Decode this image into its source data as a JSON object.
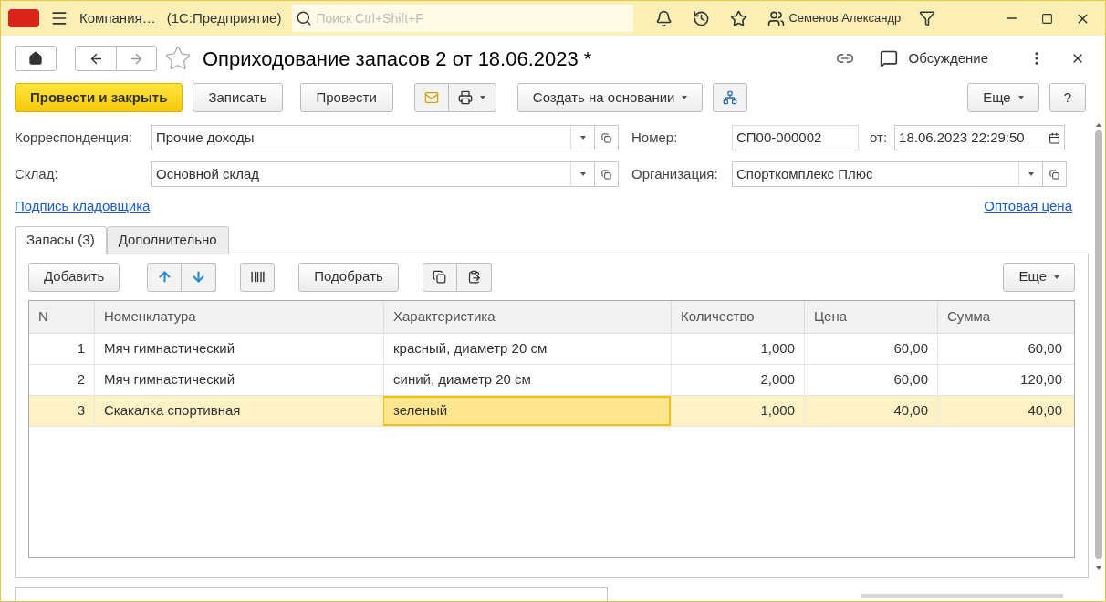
{
  "topbar": {
    "app_name": "Компания…",
    "app_kind": "(1С:Предприятие)",
    "search_placeholder": "Поиск Ctrl+Shift+F",
    "user": "Семенов Александр"
  },
  "document": {
    "title": "Оприходование запасов 2 от 18.06.2023 *",
    "discussion": "Обсуждение",
    "favorite": false
  },
  "command_bar": {
    "primary": "Провести и закрыть",
    "write": "Записать",
    "post": "Провести",
    "create_based": "Создать на основании",
    "more": "Еще",
    "help": "?"
  },
  "fields": [
    {
      "label": "Корреспонденция:",
      "value": "Прочие доходы"
    },
    {
      "label": "Номер:",
      "value": "СП00-000002",
      "date_label": "от:",
      "date": "18.06.2023 22:29:50"
    },
    {
      "label": "Склад:",
      "value": "Основной склад"
    },
    {
      "label": "Организация:",
      "value": "Спорткомплекс Плюс"
    }
  ],
  "links": {
    "left": "Подпись кладовщика",
    "right": "Оптовая цена"
  },
  "tabs": [
    {
      "label": "Запасы (3)",
      "selected": true
    },
    {
      "label": "Дополнительно",
      "selected": false
    }
  ],
  "table_toolbar": {
    "add": "Добавить",
    "pick": "Подобрать",
    "more": "Еще"
  },
  "table": {
    "columns": [
      "N",
      "Номенклатура",
      "Характеристика",
      "Количество",
      "Цена",
      "Сумма"
    ],
    "rows": [
      {
        "cells": [
          "1",
          "Мяч гимнастический",
          "красный, диаметр 20 см",
          "1,000",
          "60,00",
          "60,00"
        ],
        "selected": false
      },
      {
        "cells": [
          "2",
          "Мяч гимнастический",
          "синий, диаметр 20 см",
          "2,000",
          "60,00",
          "120,00"
        ],
        "selected": false
      },
      {
        "cells": [
          "3",
          "Скакалка спортивная",
          {
            "text": "зеленый",
            "active": true
          },
          "1,000",
          "40,00",
          "40,00"
        ],
        "selected": true
      }
    ]
  }
}
